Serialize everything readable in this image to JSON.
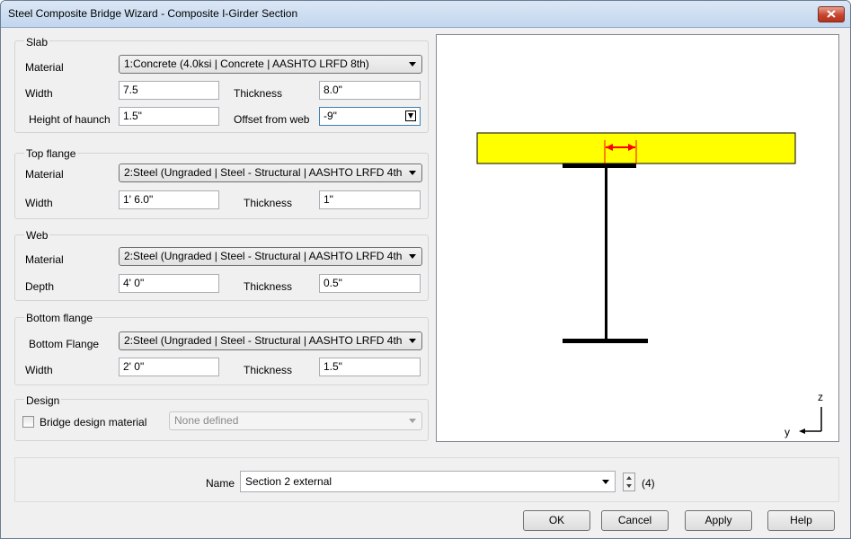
{
  "window": {
    "title": "Steel Composite Bridge Wizard - Composite I-Girder Section"
  },
  "slab": {
    "title": "Slab",
    "material_label": "Material",
    "material_value": "1:Concrete (4.0ksi | Concrete | AASHTO LRFD 8th)",
    "width_label": "Width",
    "width_value": "7.5",
    "thickness_label": "Thickness",
    "thickness_value": "8.0\"",
    "haunch_label": "Height of haunch",
    "haunch_value": "1.5\"",
    "offset_label": "Offset from web",
    "offset_value": "-9\""
  },
  "top_flange": {
    "title": "Top flange",
    "material_label": "Material",
    "material_value": "2:Steel (Ungraded | Steel - Structural | AASHTO LRFD 4th",
    "width_label": "Width",
    "width_value": "1' 6.0\"",
    "thickness_label": "Thickness",
    "thickness_value": "1\""
  },
  "web": {
    "title": "Web",
    "material_label": "Material",
    "material_value": "2:Steel (Ungraded | Steel - Structural | AASHTO LRFD 4th",
    "depth_label": "Depth",
    "depth_value": "4' 0\"",
    "thickness_label": "Thickness",
    "thickness_value": "0.5\""
  },
  "bottom_flange": {
    "title": "Bottom flange",
    "material_label": "Bottom Flange",
    "material_value": "2:Steel (Ungraded | Steel - Structural | AASHTO LRFD 4th",
    "width_label": "Width",
    "width_value": "2' 0\"",
    "thickness_label": "Thickness",
    "thickness_value": "1.5\""
  },
  "design": {
    "title": "Design",
    "checkbox_label": "Bridge design material",
    "checked": false,
    "material_value": "None defined"
  },
  "preview": {
    "axis_z": "z",
    "axis_y": "y",
    "colors": {
      "slab": "#ffff00",
      "steel": "#000000",
      "offset_marker": "#ff0000"
    }
  },
  "name_bar": {
    "label": "Name",
    "value": "Section 2 external",
    "count": "(4)"
  },
  "buttons": {
    "ok": "OK",
    "cancel": "Cancel",
    "apply": "Apply",
    "help": "Help"
  }
}
